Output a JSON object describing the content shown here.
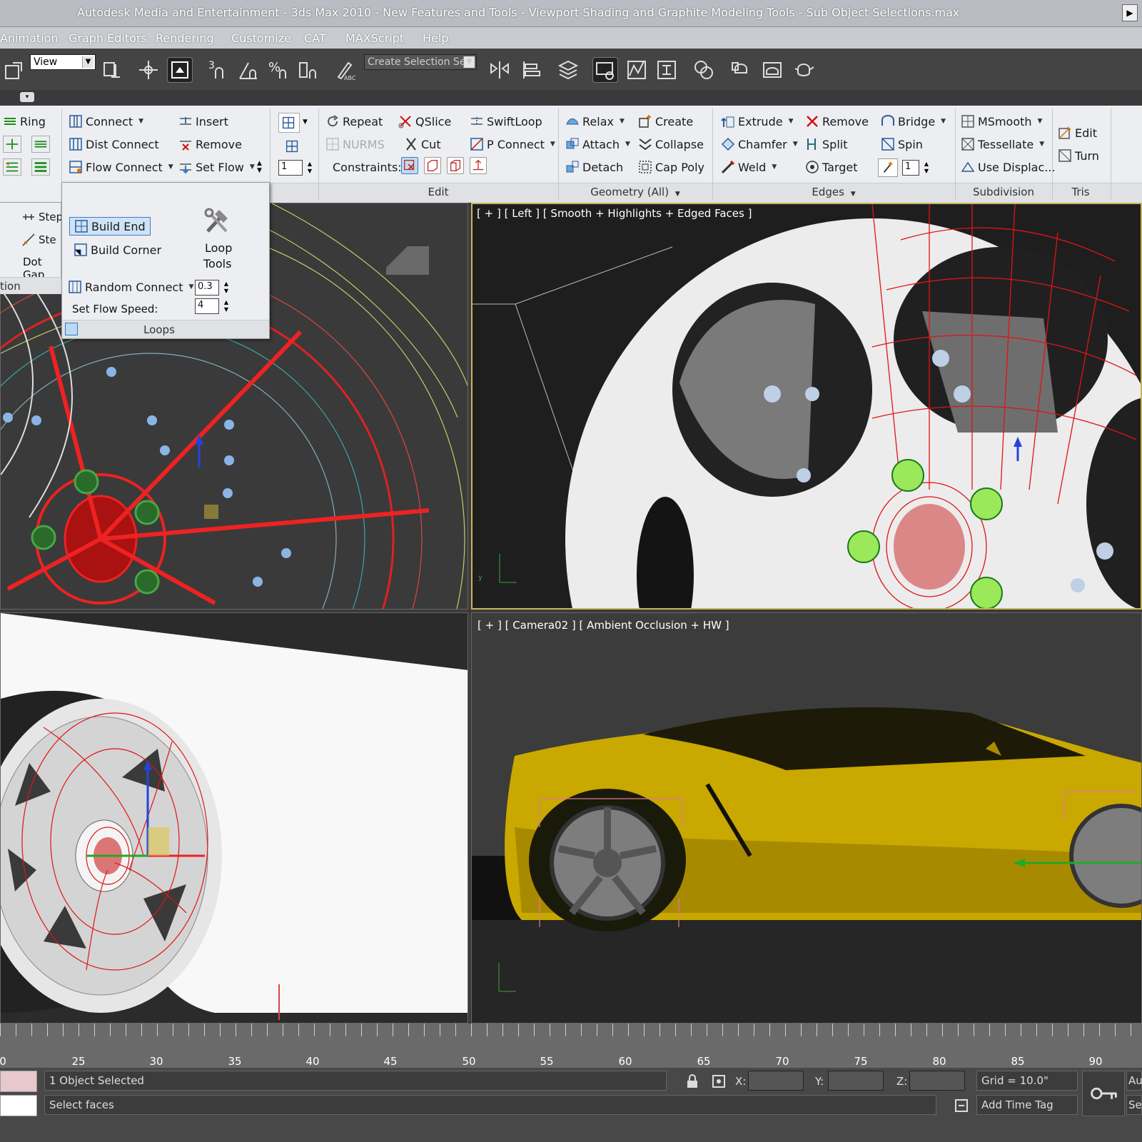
{
  "window": {
    "title": "Autodesk Media and Entertainment - 3ds Max 2010 - New Features and Tools - Viewport Shading and Graphite Modeling Tools - Sub Object Selections.max",
    "close": "▶"
  },
  "menu": [
    "Animation",
    "Graph Editors",
    "Rendering",
    "Customize",
    "CAT",
    "MAXScript",
    "Help"
  ],
  "toolbar": {
    "view_dropdown": "View",
    "selection_set_placeholder": "Create Selection Se",
    "snap_label": "3",
    "pct_label": "%"
  },
  "ribbon": {
    "loops_left": {
      "ring": "Ring"
    },
    "connect": {
      "connect": "Connect",
      "dist_connect": "Dist Connect",
      "flow_connect": "Flow Connect",
      "insert": "Insert",
      "remove": "Remove",
      "set_flow": "Set Flow",
      "spin_value": "1"
    },
    "edit": {
      "repeat": "Repeat",
      "qslice": "QSlice",
      "swiftloop": "SwiftLoop",
      "nurms": "NURMS",
      "cut": "Cut",
      "p_connect": "P Connect",
      "constraints": "Constraints:",
      "label": "Edit"
    },
    "geometry": {
      "relax": "Relax",
      "create": "Create",
      "attach": "Attach",
      "collapse": "Collapse",
      "detach": "Detach",
      "cap_poly": "Cap Poly",
      "label": "Geometry (All)"
    },
    "edges": {
      "extrude": "Extrude",
      "remove": "Remove",
      "bridge": "Bridge",
      "chamfer": "Chamfer",
      "split": "Split",
      "spin": "Spin",
      "weld": "Weld",
      "target": "Target",
      "spin_value": "1",
      "label": "Edges"
    },
    "subdivision": {
      "msmooth": "MSmooth",
      "tessellate": "Tessellate",
      "use_displac": "Use Displac...",
      "label": "Subdivision"
    },
    "tris": {
      "edit": "Edit",
      "turn": "Turn",
      "label": "Tris"
    }
  },
  "loops_panel": {
    "build_end": "Build End",
    "build_corner": "Build Corner",
    "loop_tools_1": "Loop",
    "loop_tools_2": "Tools",
    "random_connect": "Random Connect",
    "random_value": "0.3",
    "set_flow_speed": "Set Flow Speed:",
    "flow_speed_value": "4",
    "label": "Loops"
  },
  "left_strip": {
    "step1": "Step",
    "step2": "Ste",
    "dot_gap": "Dot Gap",
    "tion": "tion"
  },
  "viewports": {
    "left": "[ + ] [ Left ] [ Smooth + Highlights + Edged Faces ]",
    "camera": "[ + ] [ Camera02 ] [ Ambient Occlusion + HW ]"
  },
  "timeline": {
    "ticks": [
      "0",
      "25",
      "30",
      "35",
      "40",
      "45",
      "50",
      "55",
      "60",
      "65",
      "70",
      "75",
      "80",
      "85",
      "90"
    ]
  },
  "status": {
    "selected": "1 Object Selected",
    "prompt": "Select faces",
    "x_label": "X:",
    "y_label": "Y:",
    "z_label": "Z:",
    "grid": "Grid = 10.0\"",
    "add_time_tag": "Add Time Tag",
    "auto": "Au",
    "se": "Se"
  },
  "colors": {
    "car_body": "#c9a800",
    "wire_red": "#e01010",
    "wire_yellow": "#d8d85a",
    "viewport_dark": "#2b2b2b"
  }
}
